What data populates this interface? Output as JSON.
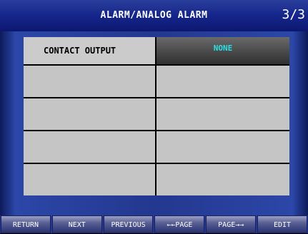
{
  "header": {
    "title": "ALARM/ANALOG ALARM",
    "page": "3/3"
  },
  "table": {
    "rows": [
      {
        "label": "CONTACT OUTPUT",
        "value": "NONE"
      },
      {
        "label": "",
        "value": ""
      },
      {
        "label": "",
        "value": ""
      },
      {
        "label": "",
        "value": ""
      },
      {
        "label": "",
        "value": ""
      }
    ]
  },
  "footer": {
    "buttons": [
      "RETURN",
      "NEXT",
      "PREVIOUS",
      "←←PAGE",
      "PAGE→→",
      "EDIT"
    ]
  },
  "colors": {
    "header": "#15258a",
    "value_text": "#2ae0e8",
    "cell": "#c5c5c5"
  }
}
